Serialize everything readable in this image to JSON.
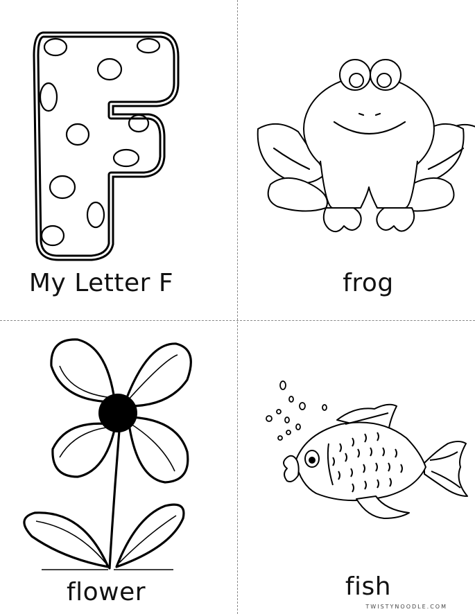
{
  "panels": [
    {
      "caption": "My Letter F",
      "picture": "polka-dot-letter-f"
    },
    {
      "caption": "frog",
      "picture": "frog"
    },
    {
      "caption": "flower",
      "picture": "flower"
    },
    {
      "caption": "fish",
      "picture": "fish"
    }
  ],
  "footer": {
    "brand": "TWISTYNOODLE.COM"
  }
}
